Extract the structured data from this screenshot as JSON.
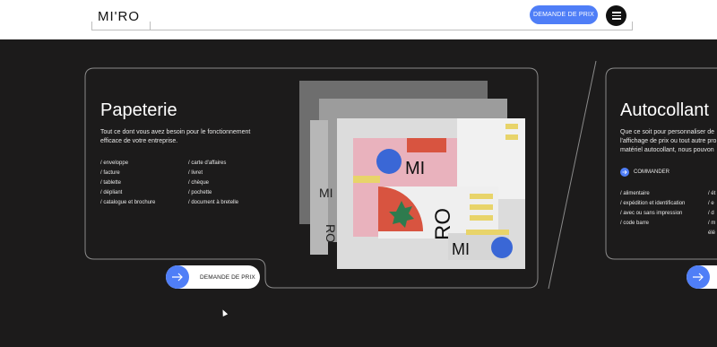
{
  "header": {
    "logo_text": "MI'RO",
    "quote_button_label": "DEMANDE DE PRIX",
    "menu_icon": "hamburger-icon",
    "accent_color": "#4f7ef7"
  },
  "cards": {
    "papeterie": {
      "title": "Papeterie",
      "description": "Tout ce dont vous avez besoin pour le fonctionnement efficace de votre entreprise.",
      "list_left": [
        "/ enveloppe",
        "/ facture",
        "/ tablette",
        "/ dépliant",
        "/ catalogue et brochure"
      ],
      "list_right": [
        "/ carte d'affaires",
        "/ livret",
        "/ chèque",
        "/ pochette",
        "/ document à bretelle"
      ],
      "cta_label": "DEMANDE DE PRIX"
    },
    "autocollant": {
      "title": "Autocollant",
      "description_lines": [
        "Que ce soit pour personnaliser de",
        "l'affichage de prix ou tout autre pro",
        "matériel autocollant, nous pouvon"
      ],
      "command_label": "COMMANDER",
      "list_left": [
        "/ alimentaire",
        "/ expédition et identification",
        "/ avec ou sans impression",
        "/ code barre"
      ],
      "list_right": [
        "/ ét",
        "/ e",
        "/ d",
        "/ m",
        "élé"
      ]
    }
  },
  "mockup_text": {
    "mi_1": "MI",
    "ro": "RO",
    "mi_2": "MI",
    "mi_side": "MI",
    "ro_side": "RO"
  }
}
